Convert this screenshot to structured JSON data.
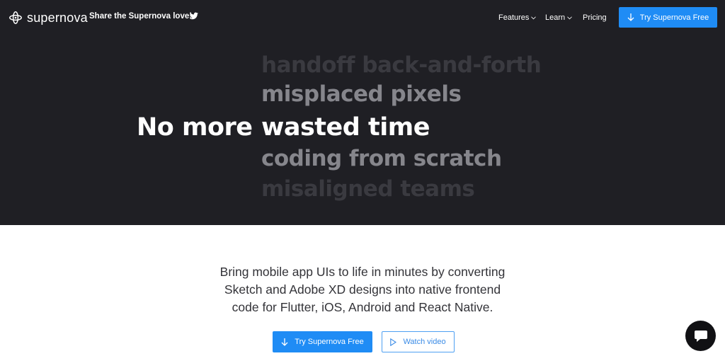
{
  "brand": {
    "name": "supernova",
    "logo_icon": "supernova-logo-icon"
  },
  "header": {
    "share_text": "Share the Supernova love!",
    "share_icon": "twitter-icon",
    "nav": [
      {
        "label": "Features",
        "has_dropdown": true
      },
      {
        "label": "Learn",
        "has_dropdown": true
      },
      {
        "label": "Pricing",
        "has_dropdown": false
      }
    ],
    "cta_label": "Try Supernova Free"
  },
  "hero": {
    "prefix": "No more",
    "phrases": [
      "handoff back-and-forth",
      "misplaced pixels",
      "wasted time",
      "coding from scratch",
      "misaligned teams"
    ],
    "active_phrase_index": 2
  },
  "main": {
    "description_lines": [
      "Bring mobile app UIs to life in minutes by converting",
      "Sketch and Adobe XD designs into native frontend",
      "code for Flutter, iOS, Android and React Native."
    ],
    "primary_button": "Try Supernova Free",
    "secondary_button": "Watch video"
  },
  "colors": {
    "accent": "#1f8cf5",
    "hero_bg": "#1f1f24",
    "chat_bg": "#111114"
  },
  "chat": {
    "icon": "chat-bubble-icon"
  }
}
